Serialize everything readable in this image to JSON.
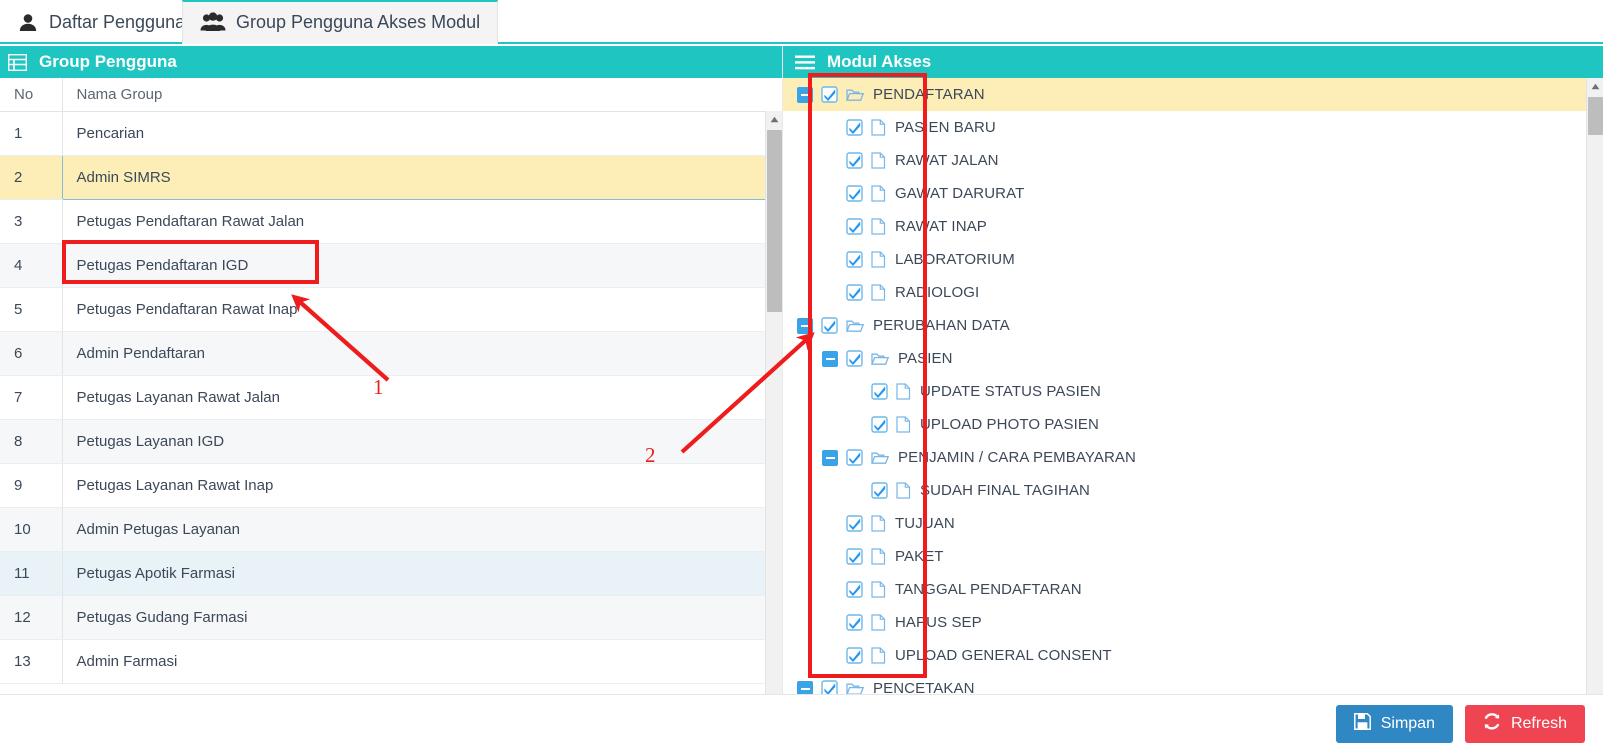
{
  "tabs": [
    {
      "label": "Daftar Pengguna",
      "icon": "user-icon",
      "active": false
    },
    {
      "label": "Group Pengguna Akses Modul",
      "icon": "users-icon",
      "active": true
    }
  ],
  "left_panel": {
    "title": "Group Pengguna",
    "header_icon": "list-grid-icon",
    "columns": [
      "No",
      "Nama Group"
    ],
    "rows": [
      {
        "no": "1",
        "nama": "Pencarian",
        "state": "odd"
      },
      {
        "no": "2",
        "nama": "Admin SIMRS",
        "state": "selected"
      },
      {
        "no": "3",
        "nama": "Petugas Pendaftaran Rawat Jalan",
        "state": "odd"
      },
      {
        "no": "4",
        "nama": "Petugas Pendaftaran IGD",
        "state": "even"
      },
      {
        "no": "5",
        "nama": "Petugas Pendaftaran Rawat Inap",
        "state": "odd"
      },
      {
        "no": "6",
        "nama": "Admin Pendaftaran",
        "state": "even"
      },
      {
        "no": "7",
        "nama": "Petugas Layanan Rawat Jalan",
        "state": "odd"
      },
      {
        "no": "8",
        "nama": "Petugas Layanan IGD",
        "state": "even"
      },
      {
        "no": "9",
        "nama": "Petugas Layanan Rawat Inap",
        "state": "odd"
      },
      {
        "no": "10",
        "nama": "Admin Petugas Layanan",
        "state": "even"
      },
      {
        "no": "11",
        "nama": "Petugas Apotik Farmasi",
        "state": "hovered"
      },
      {
        "no": "12",
        "nama": "Petugas Gudang Farmasi",
        "state": "even"
      },
      {
        "no": "13",
        "nama": "Admin Farmasi",
        "state": "odd"
      }
    ]
  },
  "right_panel": {
    "title": "Modul Akses",
    "header_icon": "hamburger-icon",
    "tree": [
      {
        "label": "PENDAFTARAN",
        "depth": 0,
        "type": "folder",
        "checked": true,
        "toggle": "minus",
        "highlighted": true
      },
      {
        "label": "PASIEN BARU",
        "depth": 1,
        "type": "file",
        "checked": true,
        "toggle": "none",
        "highlighted": false
      },
      {
        "label": "RAWAT JALAN",
        "depth": 1,
        "type": "file",
        "checked": true,
        "toggle": "none",
        "highlighted": false
      },
      {
        "label": "GAWAT DARURAT",
        "depth": 1,
        "type": "file",
        "checked": true,
        "toggle": "none",
        "highlighted": false
      },
      {
        "label": "RAWAT INAP",
        "depth": 1,
        "type": "file",
        "checked": true,
        "toggle": "none",
        "highlighted": false
      },
      {
        "label": "LABORATORIUM",
        "depth": 1,
        "type": "file",
        "checked": true,
        "toggle": "none",
        "highlighted": false
      },
      {
        "label": "RADIOLOGI",
        "depth": 1,
        "type": "file",
        "checked": true,
        "toggle": "none",
        "highlighted": false
      },
      {
        "label": "PERUBAHAN DATA",
        "depth": 0,
        "type": "folder",
        "checked": true,
        "toggle": "minus",
        "highlighted": false
      },
      {
        "label": "PASIEN",
        "depth": 1,
        "type": "folder",
        "checked": true,
        "toggle": "minus",
        "highlighted": false
      },
      {
        "label": "UPDATE STATUS PASIEN",
        "depth": 2,
        "type": "file",
        "checked": true,
        "toggle": "none",
        "highlighted": false
      },
      {
        "label": "UPLOAD PHOTO PASIEN",
        "depth": 2,
        "type": "file",
        "checked": true,
        "toggle": "none",
        "highlighted": false
      },
      {
        "label": "PENJAMIN / CARA PEMBAYARAN",
        "depth": 1,
        "type": "folder",
        "checked": true,
        "toggle": "minus",
        "highlighted": false
      },
      {
        "label": "SUDAH FINAL TAGIHAN",
        "depth": 2,
        "type": "file",
        "checked": true,
        "toggle": "none",
        "highlighted": false
      },
      {
        "label": "TUJUAN",
        "depth": 1,
        "type": "file",
        "checked": true,
        "toggle": "none",
        "highlighted": false
      },
      {
        "label": "PAKET",
        "depth": 1,
        "type": "file",
        "checked": true,
        "toggle": "none",
        "highlighted": false
      },
      {
        "label": "TANGGAL PENDAFTARAN",
        "depth": 1,
        "type": "file",
        "checked": true,
        "toggle": "none",
        "highlighted": false
      },
      {
        "label": "HAPUS SEP",
        "depth": 1,
        "type": "file",
        "checked": true,
        "toggle": "none",
        "highlighted": false
      },
      {
        "label": "UPLOAD GENERAL CONSENT",
        "depth": 1,
        "type": "file",
        "checked": true,
        "toggle": "none",
        "highlighted": false
      },
      {
        "label": "PENCETAKAN",
        "depth": 0,
        "type": "folder",
        "checked": true,
        "toggle": "minus",
        "highlighted": false
      }
    ]
  },
  "footer": {
    "save_label": "Simpan",
    "save_icon": "floppy-disk-icon",
    "refresh_label": "Refresh",
    "refresh_icon": "refresh-icon"
  },
  "annotations": {
    "marker_1": "1",
    "marker_2": "2"
  },
  "colors": {
    "accent_teal": "#1fc5c0",
    "selected_yellow": "#fdeeb8",
    "annotation_red": "#ee1c1c",
    "checkbox_blue": "#3aa3e8",
    "save_blue": "#2f87c4",
    "refresh_red": "#ef4552"
  }
}
